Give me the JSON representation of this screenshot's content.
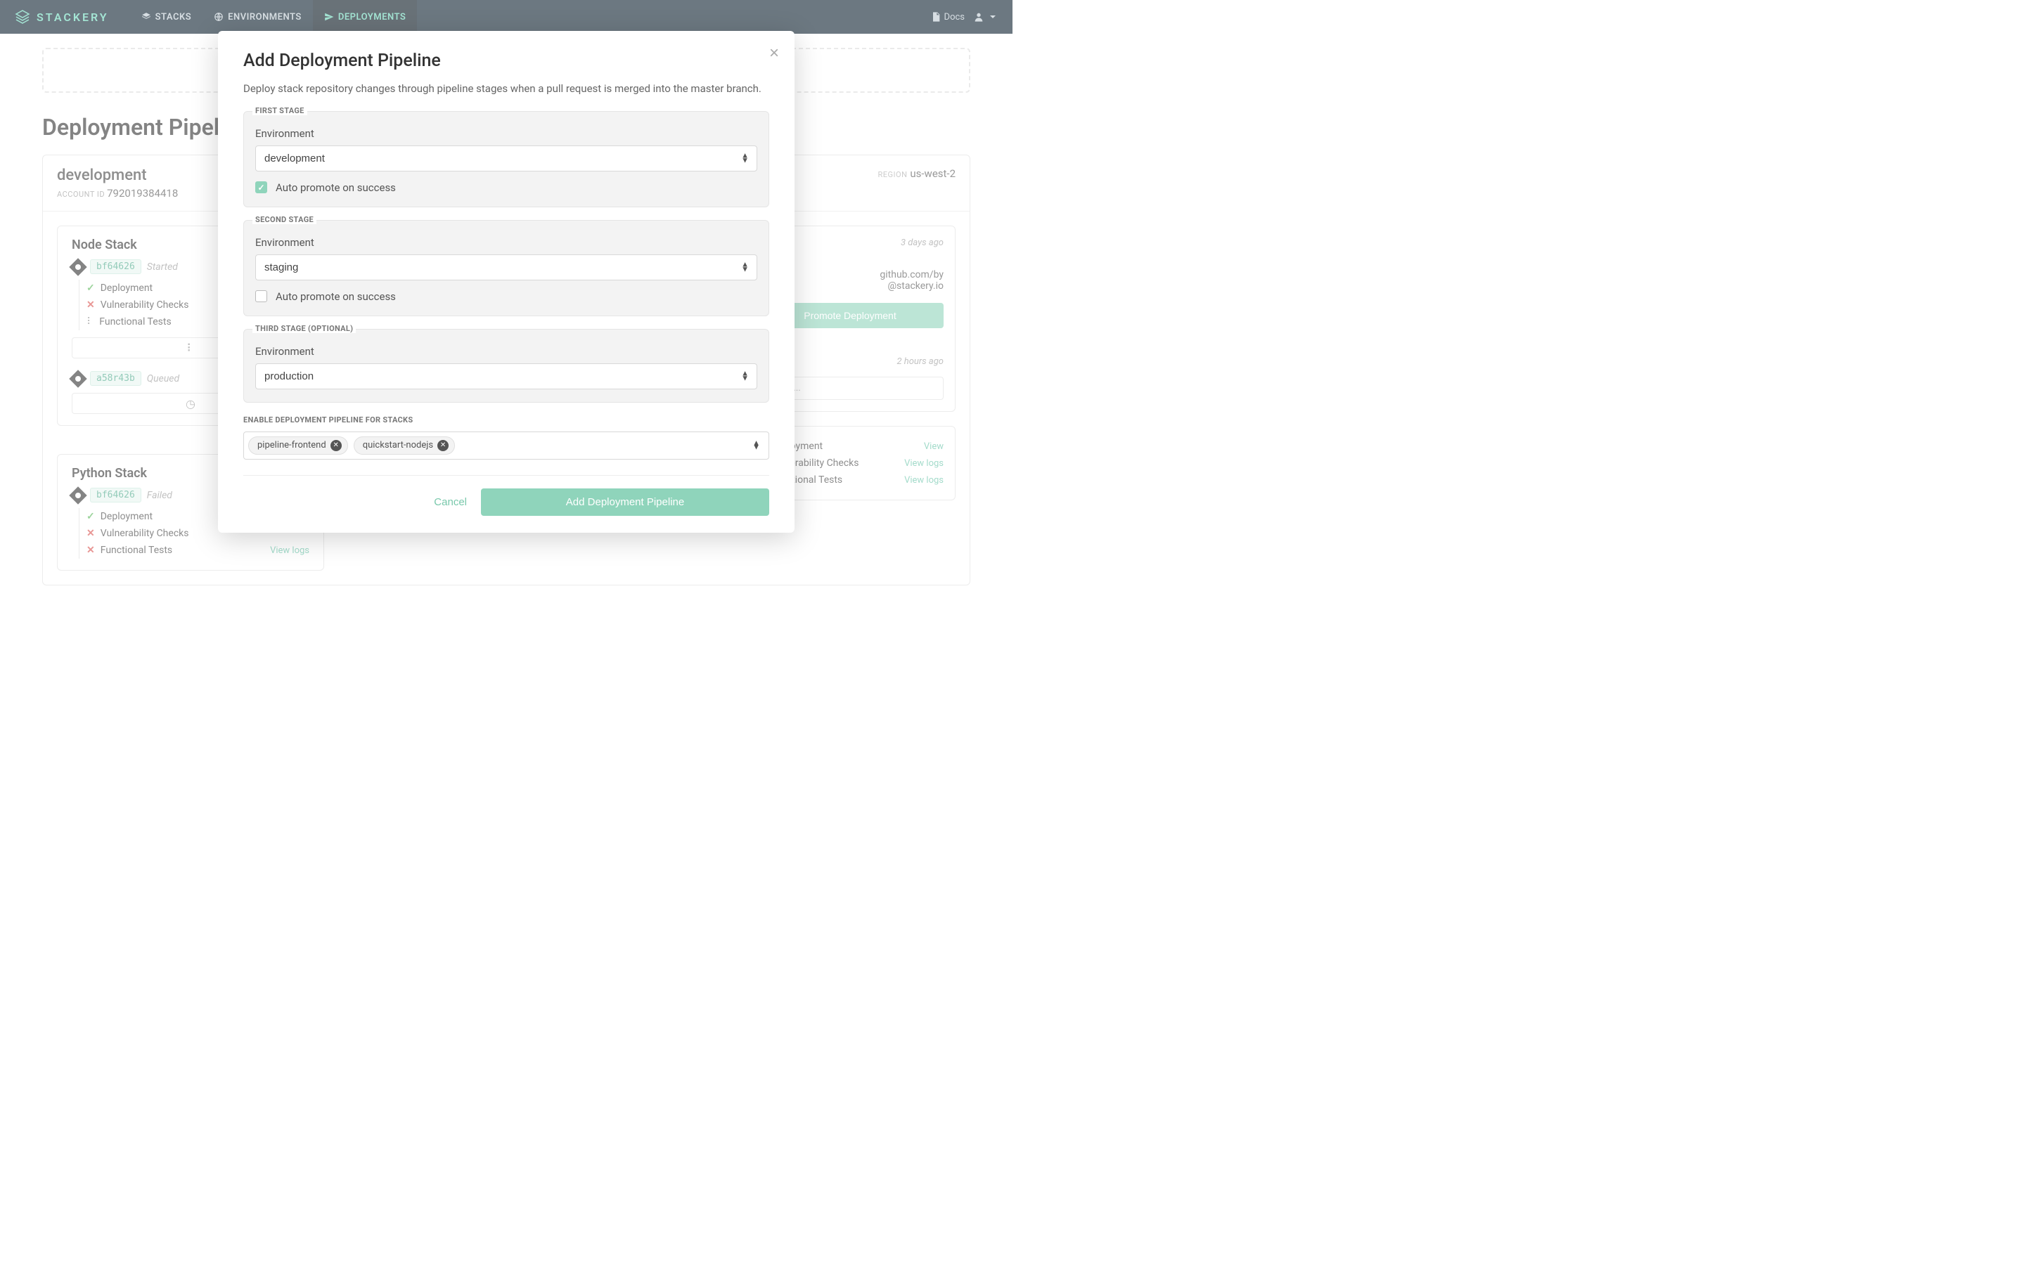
{
  "brand": "STACKERY",
  "nav": {
    "stacks": "STACKS",
    "environments": "ENVIRONMENTS",
    "deployments": "DEPLOYMENTS",
    "docs": "Docs"
  },
  "page": {
    "title": "Deployment Pipelines",
    "env": {
      "name": "development",
      "account_label": "ACCOUNT ID",
      "account_id": "792019384418",
      "region_label": "REGION",
      "region": "us-west-2"
    },
    "stacks": [
      {
        "name": "Node Stack",
        "commits": [
          {
            "hash": "bf64626",
            "status": "Started",
            "checks": [
              {
                "label": "Deployment",
                "state": "pass"
              },
              {
                "label": "Vulnerability Checks",
                "state": "fail"
              },
              {
                "label": "Functional Tests",
                "state": "wait"
              }
            ]
          },
          {
            "hash": "a58r43b",
            "status": "Queued"
          }
        ]
      },
      {
        "name": "Python Stack",
        "commits": [
          {
            "hash": "bf64626",
            "status": "Failed",
            "checks": [
              {
                "label": "Deployment",
                "state": "pass"
              },
              {
                "label": "Vulnerability Checks",
                "state": "fail"
              },
              {
                "label": "Functional Tests",
                "state": "fail",
                "link": "View logs"
              }
            ]
          }
        ]
      }
    ],
    "side": {
      "time1": "3 days ago",
      "from": "github.com/by",
      "user": "@stackery.io",
      "promote_btn": "Promote Deployment",
      "time2": "2 hours ago",
      "waiting": "Waiting...",
      "view": "View",
      "view_logs": "View logs",
      "deployment": "Deployment",
      "vuln": "Vulnerability Checks",
      "func": "Functional Tests"
    }
  },
  "modal": {
    "title": "Add Deployment Pipeline",
    "subtitle": "Deploy stack repository changes through pipeline stages when a pull request is merged into the master branch.",
    "stages": [
      {
        "label": "FIRST STAGE",
        "env_label": "Environment",
        "env_value": "development",
        "auto_label": "Auto promote on success",
        "auto_checked": true
      },
      {
        "label": "SECOND STAGE",
        "env_label": "Environment",
        "env_value": "staging",
        "auto_label": "Auto promote on success",
        "auto_checked": false
      },
      {
        "label": "THIRD STAGE (OPTIONAL)",
        "env_label": "Environment",
        "env_value": "production"
      }
    ],
    "enable_label": "ENABLE DEPLOYMENT PIPELINE FOR STACKS",
    "chips": [
      "pipeline-frontend",
      "quickstart-nodejs"
    ],
    "cancel": "Cancel",
    "submit": "Add Deployment Pipeline"
  }
}
